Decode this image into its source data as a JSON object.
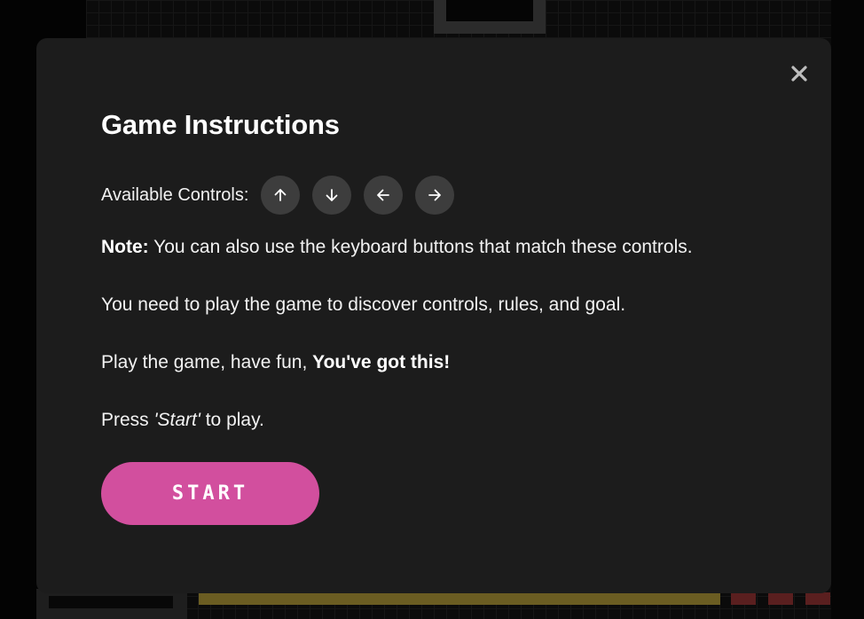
{
  "modal": {
    "title": "Game Instructions",
    "controls_label": "Available Controls:",
    "controls": [
      {
        "icon": "arrow-up-icon"
      },
      {
        "icon": "arrow-down-icon"
      },
      {
        "icon": "arrow-left-icon"
      },
      {
        "icon": "arrow-right-icon"
      }
    ],
    "note_label": "Note:",
    "note_text": " You can also use the keyboard buttons that match these controls.",
    "discover_text": "You need to play the game to discover controls, rules, and goal.",
    "play_text": "Play the game, have fun, ",
    "play_bold": "You've got this!",
    "press_prefix": "Press ",
    "press_italic": "'Start'",
    "press_suffix": " to play.",
    "start_label": "START",
    "close_icon": "close-icon"
  },
  "colors": {
    "modal_bg": "#1c1c1c",
    "control_bg": "#3d3d3d",
    "start_button": "#d24f9e",
    "text": "#f2f2f2"
  }
}
